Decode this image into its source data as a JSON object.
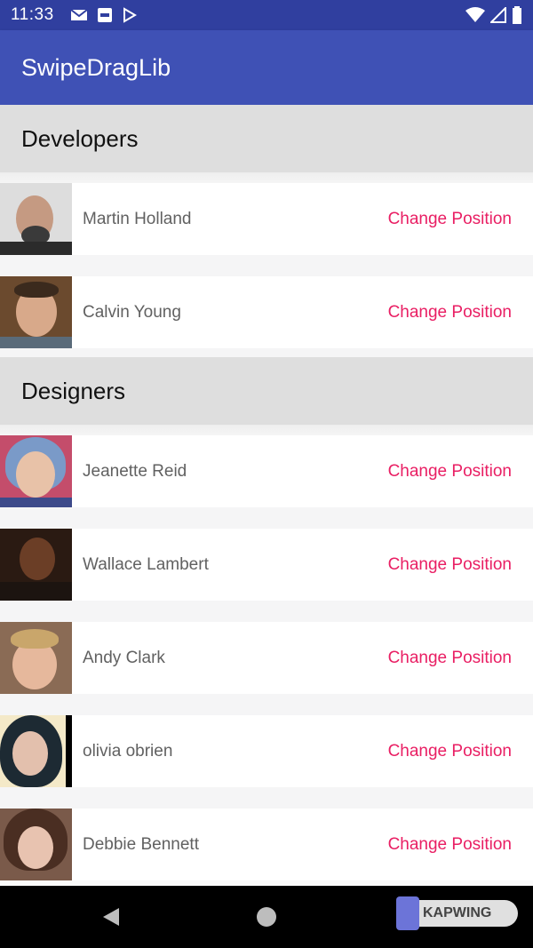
{
  "status_bar": {
    "time": "11:33"
  },
  "app_bar": {
    "title": "SwipeDragLib"
  },
  "sections": [
    {
      "header": "Developers",
      "items": [
        {
          "name": "Martin Holland",
          "action": "Change Position"
        },
        {
          "name": "Calvin Young",
          "action": "Change Position"
        }
      ]
    },
    {
      "header": "Designers",
      "items": [
        {
          "name": "Jeanette Reid",
          "action": "Change Position"
        },
        {
          "name": "Wallace Lambert",
          "action": "Change Position"
        },
        {
          "name": "Andy Clark",
          "action": "Change Position"
        },
        {
          "name": "olivia obrien",
          "action": "Change Position"
        },
        {
          "name": "Debbie Bennett",
          "action": "Change Position"
        }
      ]
    }
  ],
  "watermark": "KAPWING",
  "colors": {
    "primary": "#3f51b5",
    "primary_dark": "#303f9f",
    "accent": "#e91e63"
  }
}
